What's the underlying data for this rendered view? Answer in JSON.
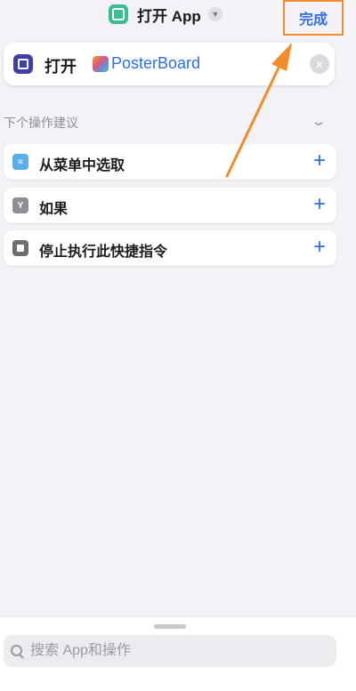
{
  "header": {
    "title": "打开 App",
    "done_label": "完成"
  },
  "action": {
    "verb": "打开",
    "app_name": "PosterBoard"
  },
  "suggestions": {
    "header": "下个操作建议",
    "items": [
      {
        "label": "从菜单中选取",
        "icon": "menu-icon",
        "color": "#5aaee8",
        "glyph": "≡"
      },
      {
        "label": "如果",
        "icon": "if-icon",
        "color": "#8e8e93",
        "glyph": "Y"
      },
      {
        "label": "停止执行此快捷指令",
        "icon": "stop-icon",
        "color": "#6d6d72",
        "glyph": "■"
      }
    ]
  },
  "search": {
    "placeholder": "搜索 App和操作"
  },
  "colors": {
    "accent": "#2f6fe0",
    "annotation": "#f28b2a",
    "app_icon": "#3bbf8f",
    "action_icon": "#3f3fa5"
  }
}
